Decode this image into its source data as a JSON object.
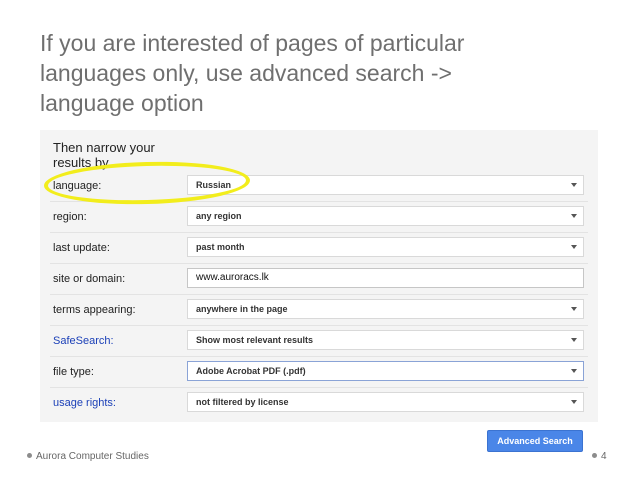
{
  "slide": {
    "title_lines": [
      "If you are interested of pages of particular",
      "languages only, use advanced search ->",
      "language option"
    ]
  },
  "form": {
    "heading_lines": [
      "Then narrow your",
      "results by..."
    ],
    "rows": [
      {
        "label": "language:",
        "value": "Russian",
        "type": "select",
        "link": false
      },
      {
        "label": "region:",
        "value": "any region",
        "type": "select",
        "link": false
      },
      {
        "label": "last update:",
        "value": "past month",
        "type": "select",
        "link": false
      },
      {
        "label": "site or domain:",
        "value": "www.auroracs.lk",
        "type": "text",
        "link": false
      },
      {
        "label": "terms appearing:",
        "value": "anywhere in the page",
        "type": "select",
        "link": false
      },
      {
        "label": "SafeSearch:",
        "value": "Show most relevant results",
        "type": "select",
        "link": true
      },
      {
        "label": "file type:",
        "value": "Adobe Acrobat PDF (.pdf)",
        "type": "select",
        "link": false
      },
      {
        "label": "usage rights:",
        "value": "not filtered by license",
        "type": "select",
        "link": true
      }
    ],
    "submit_label": "Advanced Search"
  },
  "footer": {
    "left_text": "Aurora Computer Studies",
    "page_number": "4"
  },
  "colors": {
    "highlight": "#f2ed1c",
    "button": "#4a86e8",
    "link": "#1a3fb7"
  }
}
